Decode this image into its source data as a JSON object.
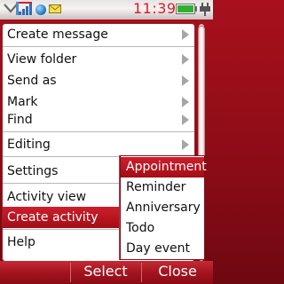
{
  "status": {
    "time": "11:39",
    "icons": [
      "chevron-down-icon",
      "signal-icon",
      "globe-icon",
      "mail-icon",
      "battery-icon",
      "charger-plug-icon"
    ]
  },
  "colors": {
    "accent": "#b3121e",
    "highlight": "#cc1f2b",
    "time_text": "#d71b25"
  },
  "menu": {
    "items": [
      {
        "label": "Create message",
        "submenu": true
      },
      {
        "label": "View folder",
        "submenu": true
      },
      {
        "label": "Send as",
        "submenu": true
      },
      {
        "label": "Mark",
        "submenu": true
      },
      {
        "label": "Find",
        "submenu": true
      },
      {
        "label": "Editing",
        "submenu": true
      },
      {
        "label": "Settings",
        "submenu": false
      },
      {
        "label": "Activity view",
        "submenu": false
      },
      {
        "label": "Create activity",
        "submenu": false,
        "selected": true
      },
      {
        "label": "Help",
        "submenu": false
      }
    ]
  },
  "submenu": {
    "items": [
      {
        "label": "Appointment",
        "selected": true
      },
      {
        "label": "Reminder"
      },
      {
        "label": "Anniversary"
      },
      {
        "label": "Todo"
      },
      {
        "label": "Day event"
      }
    ]
  },
  "softkeys": {
    "left": "",
    "center": "Select",
    "right": "Close"
  }
}
